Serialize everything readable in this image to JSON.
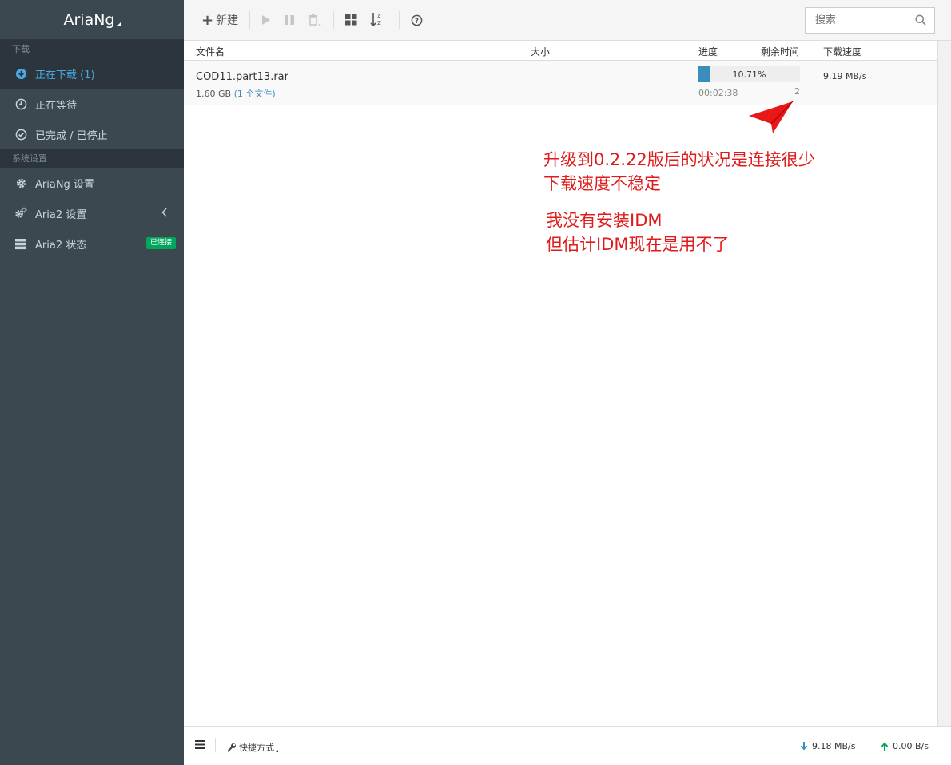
{
  "app": {
    "title": "AriaNg"
  },
  "sidebar": {
    "section_download": "下载",
    "section_settings": "系统设置",
    "items": [
      {
        "label": "正在下载 (1)",
        "icon": "download-icon"
      },
      {
        "label": "正在等待",
        "icon": "clock-icon"
      },
      {
        "label": "已完成 / 已停止",
        "icon": "check-circle-icon"
      },
      {
        "label": "AriaNg 设置",
        "icon": "gear-icon"
      },
      {
        "label": "Aria2 设置",
        "icon": "gears-icon"
      },
      {
        "label": "Aria2 状态",
        "icon": "server-icon"
      }
    ],
    "status_badge": "已连接"
  },
  "toolbar": {
    "new_label": "新建",
    "search_placeholder": "搜索"
  },
  "table": {
    "headers": {
      "name": "文件名",
      "size": "大小",
      "progress": "进度",
      "remaining": "剩余时间",
      "speed": "下载速度"
    },
    "rows": [
      {
        "name": "COD11.part13.rar",
        "size": "1.60 GB",
        "files": "(1 个文件)",
        "progress_text": "10.71%",
        "progress_value": 0.1071,
        "remaining": "00:02:38",
        "connections": "2",
        "speed": "9.19 MB/s"
      }
    ]
  },
  "annotation": {
    "line1": "升级到0.2.22版后的状况是连接很少",
    "line2": "下载速度不稳定",
    "line3": "我没有安装IDM",
    "line4": "但估计IDM现在是用不了",
    "color": "#e01b1b"
  },
  "footer": {
    "shortcut_label": "快捷方式",
    "download_speed": "9.18 MB/s",
    "upload_speed": "0.00 B/s"
  }
}
